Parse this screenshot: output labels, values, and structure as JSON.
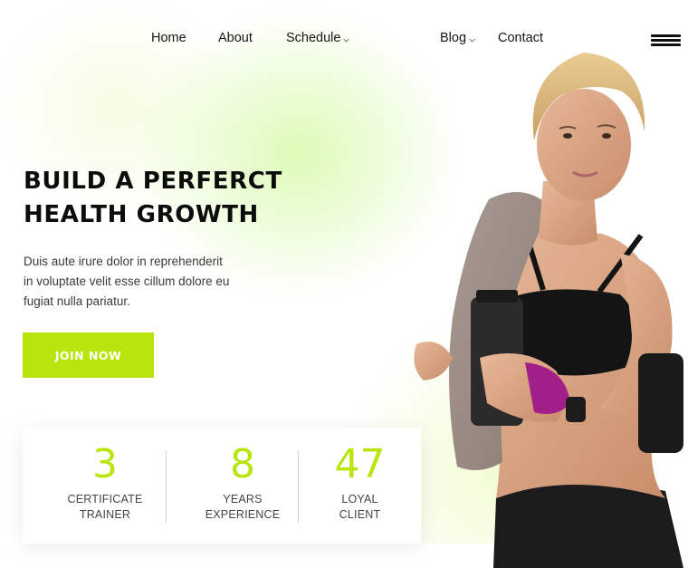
{
  "nav": {
    "items": [
      {
        "label": "Home",
        "has_dropdown": false
      },
      {
        "label": "About",
        "has_dropdown": false
      },
      {
        "label": "Schedule",
        "has_dropdown": true
      },
      {
        "label": "Blog",
        "has_dropdown": true
      },
      {
        "label": "Contact",
        "has_dropdown": false
      }
    ],
    "menu_icon": "hamburger-icon"
  },
  "hero": {
    "title_line1": "BUILD A PERFERCT",
    "title_line2": "HEALTH GROWTH",
    "text_line1": "Duis aute irure dolor in reprehenderit",
    "text_line2": "in voluptate velit esse cillum dolore eu",
    "text_line3": "fugiat nulla pariatur.",
    "cta_label": "JOIN NOW"
  },
  "stats": [
    {
      "number": "3",
      "label_line1": "CERTIFICATE",
      "label_line2": "TRAINER"
    },
    {
      "number": "8",
      "label_line1": "YEARS",
      "label_line2": "EXPERIENCE"
    },
    {
      "number": "47",
      "label_line1": "LOYAL",
      "label_line2": "CLIENT"
    }
  ],
  "colors": {
    "accent": "#b8e60c",
    "text_dark": "#111111",
    "glow": "#d6faaa"
  }
}
